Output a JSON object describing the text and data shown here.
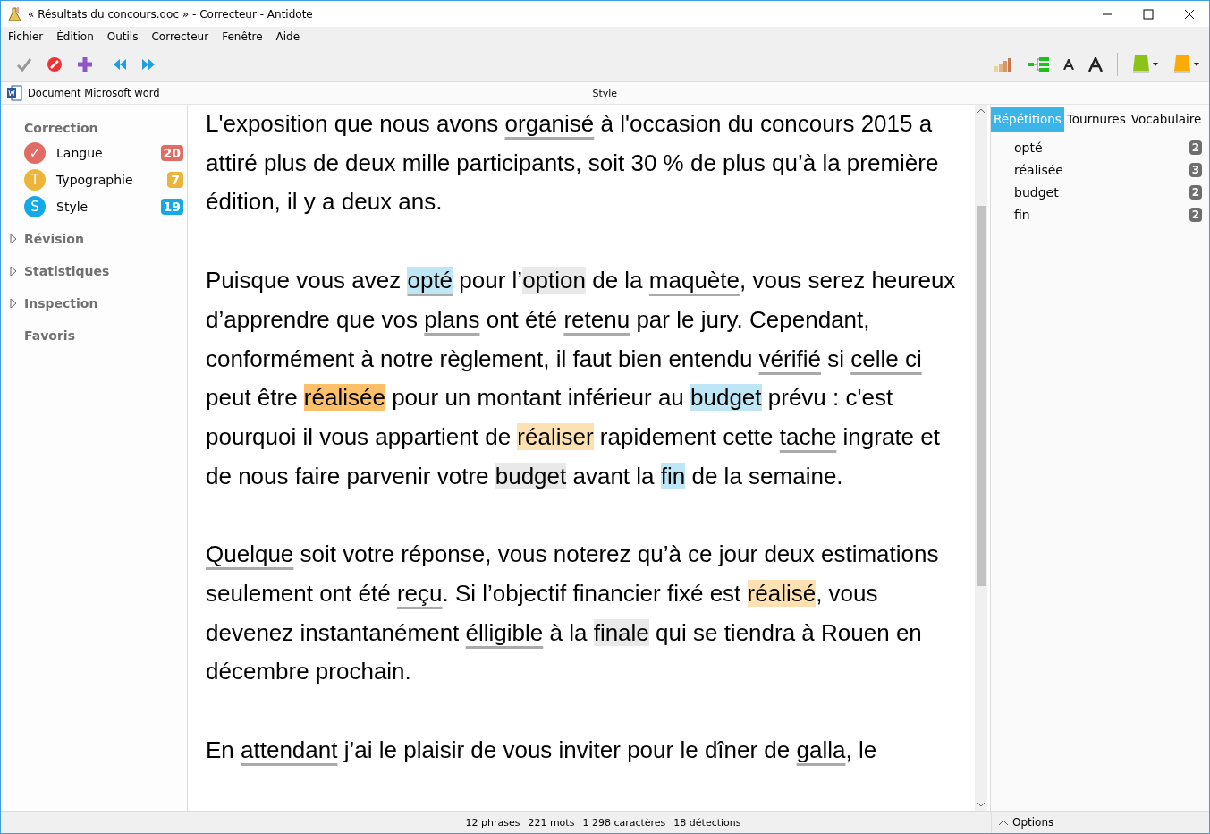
{
  "window": {
    "title": "« Résultats du concours.doc » - Correcteur - Antidote"
  },
  "menu": [
    "Fichier",
    "Édition",
    "Outils",
    "Correcteur",
    "Fenêtre",
    "Aide"
  ],
  "doc_bar": {
    "source": "Document Microsoft word",
    "mode": "Style"
  },
  "sidebar": {
    "header": "Correction",
    "items": [
      {
        "label": "Langue",
        "letter": "✓",
        "count": "20",
        "color": "#e06c64"
      },
      {
        "label": "Typographie",
        "letter": "T",
        "count": "7",
        "color": "#ecb53a"
      },
      {
        "label": "Style",
        "letter": "S",
        "count": "19",
        "color": "#14a8e6"
      }
    ],
    "sections": [
      {
        "label": "Révision",
        "expanded": false
      },
      {
        "label": "Statistiques",
        "expanded": false
      },
      {
        "label": "Inspection",
        "expanded": false
      },
      {
        "label": "Favoris"
      }
    ]
  },
  "paragraphs": [
    [
      {
        "t": "L'exposition que nous avons ",
        "kind": "plain"
      },
      {
        "t": "organisé",
        "kind": "underline"
      },
      {
        "t": " à l'occasion du concours 2015 a attiré plus de deux mille participants, soit 30 % de plus qu’à la première édition, il y a deux ans.",
        "kind": "plain"
      }
    ],
    [
      {
        "t": "Puisque vous avez  ",
        "kind": "plain"
      },
      {
        "t": "opté",
        "kind": "blue-underline"
      },
      {
        "t": " pour l’",
        "kind": "plain"
      },
      {
        "t": "option",
        "kind": "grey"
      },
      {
        "t": " de la ",
        "kind": "plain"
      },
      {
        "t": "maquète",
        "kind": "underline"
      },
      {
        "t": ", vous serez heureux d’apprendre que vos ",
        "kind": "plain"
      },
      {
        "t": "plans",
        "kind": "underline"
      },
      {
        "t": " ont été ",
        "kind": "plain"
      },
      {
        "t": "retenu",
        "kind": "underline"
      },
      {
        "t": " par le jury. Cependant, conformément à notre règlement, il faut bien entendu ",
        "kind": "plain"
      },
      {
        "t": "vérifié",
        "kind": "underline"
      },
      {
        "t": " si ",
        "kind": "plain"
      },
      {
        "t": "celle ci",
        "kind": "underline"
      },
      {
        "t": "  peut être ",
        "kind": "plain"
      },
      {
        "t": "réalisée",
        "kind": "orange"
      },
      {
        "t": " pour un montant inférieur au ",
        "kind": "plain"
      },
      {
        "t": "budget",
        "kind": "blue"
      },
      {
        "t": " prévu : c'est pourquoi il vous appartient de ",
        "kind": "plain"
      },
      {
        "t": "réaliser",
        "kind": "peach"
      },
      {
        "t": " rapidement cette ",
        "kind": "plain"
      },
      {
        "t": "tache",
        "kind": "underline"
      },
      {
        "t": " ingrate et de nous faire parvenir votre ",
        "kind": "plain"
      },
      {
        "t": "budget",
        "kind": "grey"
      },
      {
        "t": " avant la ",
        "kind": "plain"
      },
      {
        "t": "fin",
        "kind": "blue"
      },
      {
        "t": " de la semaine.",
        "kind": "plain"
      }
    ],
    [
      {
        "t": "Quelque",
        "kind": "underline"
      },
      {
        "t": " soit votre réponse, vous noterez qu’à ce jour deux estimations seulement ont été ",
        "kind": "plain"
      },
      {
        "t": "reçu",
        "kind": "underline"
      },
      {
        "t": ". Si l’objectif financier fixé est ",
        "kind": "plain"
      },
      {
        "t": "réalisé",
        "kind": "peach"
      },
      {
        "t": ", vous devenez instantanément ",
        "kind": "plain"
      },
      {
        "t": "élligible",
        "kind": "underline"
      },
      {
        "t": " à la ",
        "kind": "plain"
      },
      {
        "t": "finale",
        "kind": "grey"
      },
      {
        "t": " qui se tiendra à Rouen en décembre prochain.",
        "kind": "plain"
      }
    ],
    [
      {
        "t": "En ",
        "kind": "plain"
      },
      {
        "t": "attendant",
        "kind": "underline"
      },
      {
        "t": " j’ai le plaisir de vous inviter pour le dîner de ",
        "kind": "plain"
      },
      {
        "t": "galla",
        "kind": "underline"
      },
      {
        "t": ", le",
        "kind": "plain"
      }
    ]
  ],
  "panel": {
    "tabs": [
      {
        "label": "Répétitions",
        "selected": true
      },
      {
        "label": "Tournures",
        "selected": false
      },
      {
        "label": "Vocabulaire",
        "selected": false
      }
    ],
    "items": [
      {
        "word": "opté",
        "count": "2"
      },
      {
        "word": "réalisée",
        "count": "3"
      },
      {
        "word": "budget",
        "count": "2"
      },
      {
        "word": "fin",
        "count": "2"
      }
    ],
    "options": "Options"
  },
  "status_bar": [
    "12 phrases",
    "221 mots",
    "1 298 caractères",
    "18 détections"
  ]
}
